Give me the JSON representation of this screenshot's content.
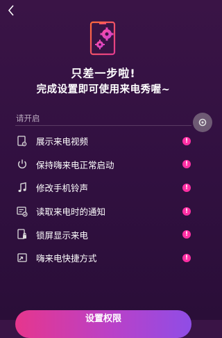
{
  "header": {
    "back_icon": "chevron-left-icon"
  },
  "hero": {
    "icon": "phone-gears-icon",
    "title": "只差一步啦!",
    "subtitle": "完成设置即可使用来电秀喔~"
  },
  "section_label": "请开启",
  "permissions": [
    {
      "icon": "video-file-icon",
      "label": "展示来电视频"
    },
    {
      "icon": "power-icon",
      "label": "保持嗨来电正常启动"
    },
    {
      "icon": "music-note-icon",
      "label": "修改手机铃声"
    },
    {
      "icon": "notification-check-icon",
      "label": "读取来电时的通知"
    },
    {
      "icon": "lock-screen-icon",
      "label": "锁屏显示来电"
    },
    {
      "icon": "shortcut-icon",
      "label": "嗨来电快捷方式"
    }
  ],
  "warn_mark": "!",
  "cta": {
    "label": "设置权限"
  },
  "colors": {
    "accent": "#ff2fa4",
    "bg": "#3a1446"
  }
}
